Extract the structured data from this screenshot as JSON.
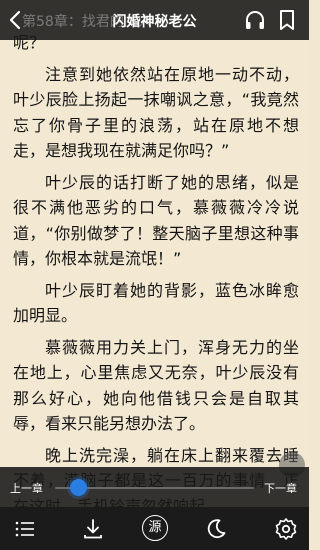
{
  "header": {
    "chapter_title": "第58章：找君的女人",
    "book_title": "闪婚神秘老公"
  },
  "content": {
    "paragraphs": [
      "呢？",
      "注意到她依然站在原地一动不动，叶少辰脸上扬起一抹嘲讽之意，“我竟然忘了你骨子里的浪荡，站在原地不想走，是想我现在就满足你吗？”",
      "叶少辰的话打断了她的思绪，似是很不满他恶劣的口气，慕薇薇冷冷说道，“你别做梦了！整天脑子里想这种事情，你根本就是流氓！”",
      "叶少辰盯着她的背影，蓝色冰眸愈加明显。",
      "慕薇薇用力关上门，浑身无力的坐在地上，心里焦虑又无奈，叶少辰没有那么好心，她向他借钱只会是自取其辱，看来只能另想办法了。",
      "晚上洗完澡，躺在床上翻来覆去睡不着，满脑子都是这一百万的事情，正在这时，手机铃声忽然响起。"
    ]
  },
  "progress": {
    "prev_label": "上一章",
    "next_label": "下一章",
    "value": 0.12
  },
  "toolbar": {
    "source_label": "源"
  },
  "colors": {
    "background": "#f3e9d3",
    "bar": "#1b1b1b",
    "accent": "#2a7de1"
  }
}
